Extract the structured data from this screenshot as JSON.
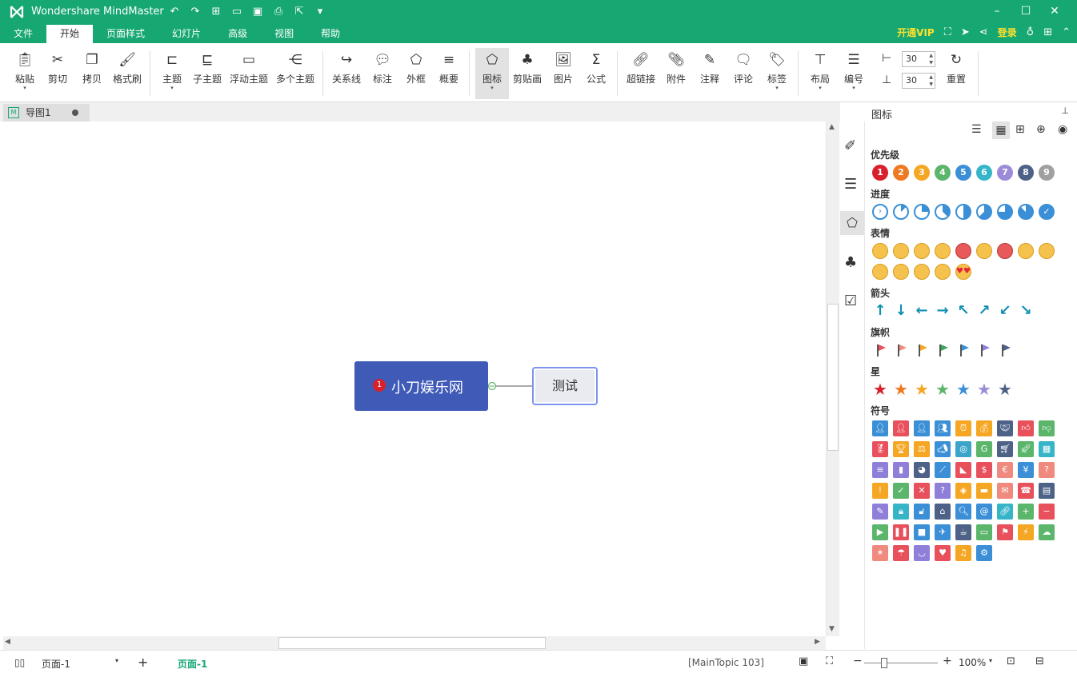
{
  "app": {
    "title": "Wondershare MindMaster"
  },
  "menu": [
    "文件",
    "开始",
    "页面样式",
    "幻灯片",
    "高级",
    "视图",
    "帮助"
  ],
  "menu_active": "开始",
  "topright": {
    "vip": "开通VIP",
    "login": "登录"
  },
  "ribbon": {
    "paste": "粘贴",
    "cut": "剪切",
    "copy": "拷贝",
    "format_painter": "格式刷",
    "topic": "主题",
    "subtopic": "子主题",
    "floating": "浮动主题",
    "multi": "多个主题",
    "relation": "关系线",
    "callout": "标注",
    "boundary": "外框",
    "summary": "概要",
    "icon": "图标",
    "clipart": "剪贴画",
    "picture": "图片",
    "formula": "公式",
    "hyperlink": "超链接",
    "attachment": "附件",
    "note": "注释",
    "comment": "评论",
    "tag": "标签",
    "layout": "布局",
    "numbering": "编号",
    "spacing_h": "30",
    "spacing_v": "30",
    "reset": "重置"
  },
  "doctab": {
    "label": "导图1"
  },
  "mindmap": {
    "main_topic": "小刀娱乐网",
    "main_marker": "1",
    "sub_topic": "测试"
  },
  "panel": {
    "title": "图标",
    "groups": {
      "priority": "优先级",
      "progress": "进度",
      "emotion": "表情",
      "arrow": "箭头",
      "flag": "旗帜",
      "star": "星",
      "symbol": "符号"
    },
    "priority_numbers": [
      "1",
      "2",
      "3",
      "4",
      "5",
      "6",
      "7",
      "8",
      "9"
    ],
    "priority_colors": [
      "#d7202b",
      "#ef7921",
      "#f5a623",
      "#5bb56a",
      "#3a8fd6",
      "#36b5c9",
      "#9b8bd8",
      "#4d6286",
      "#a0a0a0"
    ],
    "flag_colors": [
      "#e8505b",
      "#f08a7e",
      "#f5a623",
      "#3ba55c",
      "#3a8fd6",
      "#8f7fd9",
      "#4d6286"
    ],
    "star_colors": [
      "#d7202b",
      "#ef7921",
      "#f5a623",
      "#5bb56a",
      "#3a8fd6",
      "#9b8bd8",
      "#4d6286"
    ]
  },
  "status": {
    "page_select": "页面-1",
    "page_tab": "页面-1",
    "selection": "[MainTopic 103]",
    "zoom": "100%"
  },
  "colors": {
    "brand": "#17a772",
    "main_topic": "#3f5bb7",
    "sub_border": "#7c93f0"
  }
}
